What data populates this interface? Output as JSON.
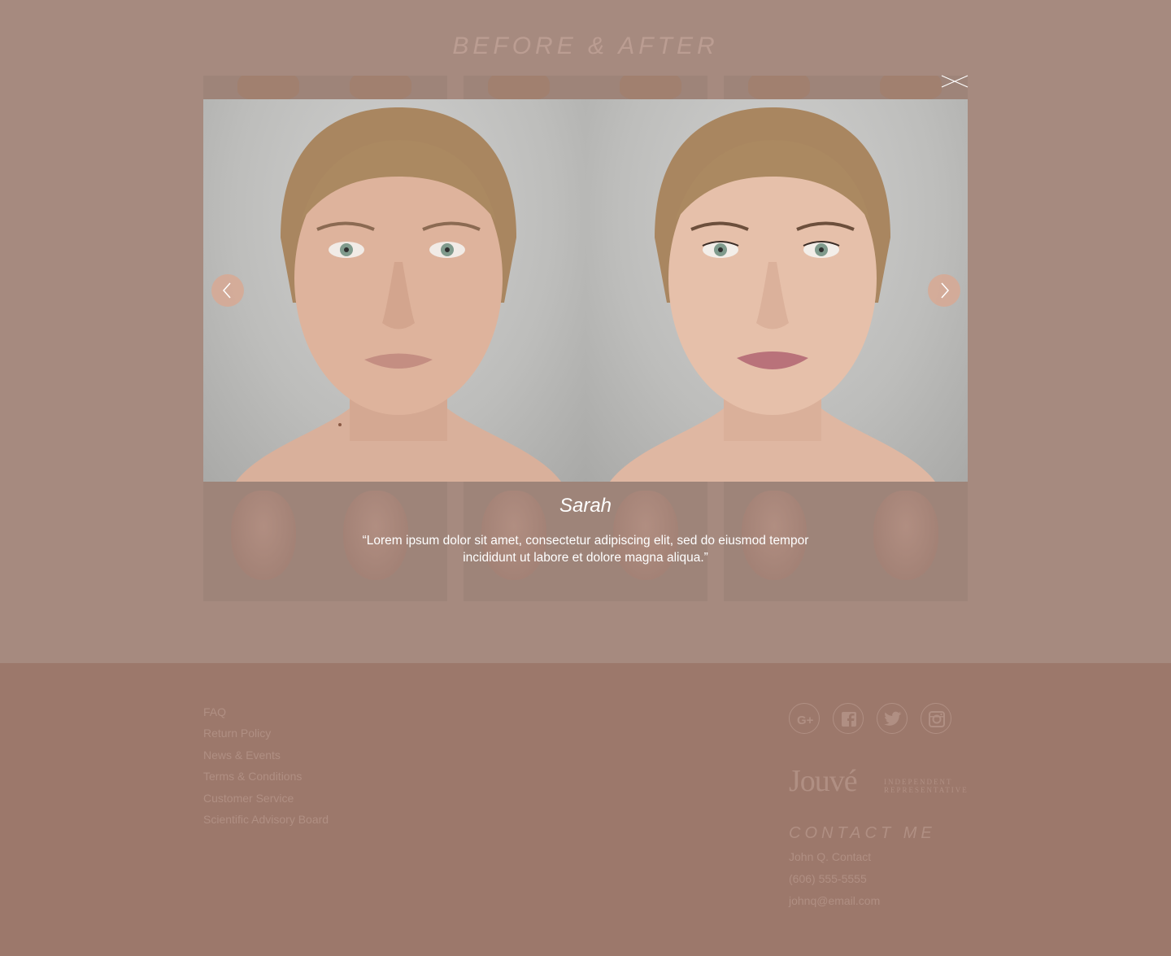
{
  "section": {
    "title": "BEFORE & AFTER"
  },
  "viewer": {
    "name": "Sarah",
    "quote": "“Lorem ipsum dolor sit amet, consectetur adipiscing elit, sed do eiusmod tempor incididunt ut labore et dolore magna aliqua.”"
  },
  "footer": {
    "links": [
      "FAQ",
      "Return Policy",
      "News & Events",
      "Terms & Conditions",
      "Customer Service",
      "Scientific Advisory Board"
    ],
    "social": [
      "google-plus-icon",
      "facebook-icon",
      "twitter-icon",
      "instagram-icon"
    ],
    "logo": {
      "word": "Jouvé",
      "sub_line_1": "Independent",
      "sub_line_2": "Representative"
    },
    "contact": {
      "title": "CONTACT ME",
      "name": "John Q. Contact",
      "phone": "(606) 555-5555",
      "email": "johnq@email.com"
    }
  },
  "colors": {
    "page_bg": "#a68a7f",
    "footer_bg": "#9c786b",
    "muted_text": "#b08f83",
    "arrow_bg": "#d6aa96"
  }
}
